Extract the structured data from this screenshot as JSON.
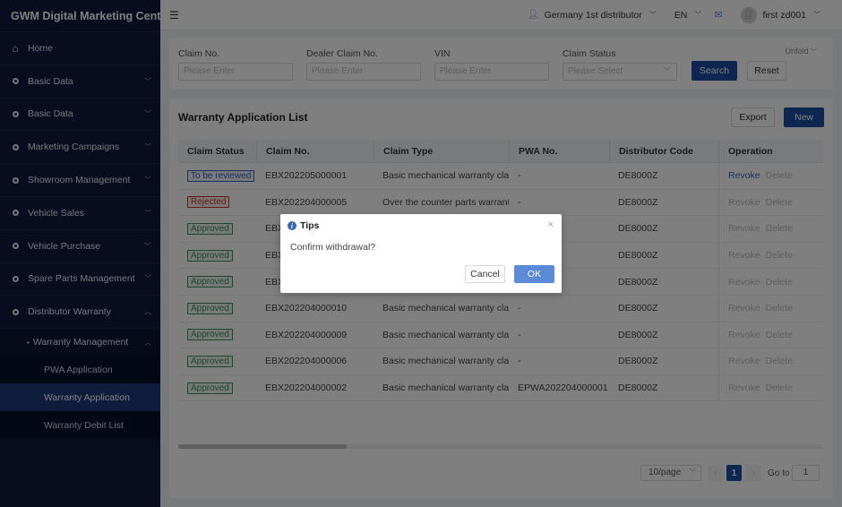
{
  "app": {
    "title": "GWM Digital Marketing Center"
  },
  "sidebar": {
    "items": [
      {
        "label": "Home",
        "icon": "home-icon"
      },
      {
        "label": "Basic Data",
        "icon": "dot-icon"
      },
      {
        "label": "Basic Data",
        "icon": "dot-icon"
      },
      {
        "label": "Marketing Campaigns",
        "icon": "dot-icon"
      },
      {
        "label": "Showroom Management",
        "icon": "dot-icon"
      },
      {
        "label": "Vehicle Sales",
        "icon": "dot-icon"
      },
      {
        "label": "Vehicle Purchase",
        "icon": "dot-icon"
      },
      {
        "label": "Spare Parts Management",
        "icon": "dot-icon"
      },
      {
        "label": "Distributor Warranty",
        "icon": "dot-icon"
      }
    ],
    "submenu": {
      "label": "Warranty Management"
    },
    "leaves": [
      {
        "label": "PWA Application",
        "active": false
      },
      {
        "label": "Warranty Application",
        "active": true
      },
      {
        "label": "Warranty Debit List",
        "active": false
      }
    ]
  },
  "header": {
    "distributor": "Germany 1st distributor",
    "language": "EN",
    "username": "first zd001"
  },
  "filter": {
    "claim_no_label": "Claim No.",
    "claim_no_placeholder": "Please Enter",
    "dealer_claim_label": "Dealer Claim No.",
    "dealer_claim_placeholder": "Please Enter",
    "vin_label": "VIN",
    "vin_placeholder": "Please Enter",
    "status_label": "Claim Status",
    "status_placeholder": "Please Select",
    "search_label": "Search",
    "reset_label": "Reset",
    "unfold_label": "Unfold"
  },
  "list": {
    "title": "Warranty Application List",
    "export_label": "Export",
    "new_label": "New",
    "columns": [
      "Claim Status",
      "Claim No.",
      "Claim Type",
      "PWA No.",
      "Distributor Code",
      "Operation"
    ],
    "rows": [
      {
        "status": "To be reviewed",
        "status_color": "blue",
        "claim_no": "EBX202205000001",
        "type": "Basic mechanical warranty claim",
        "pwa": "-",
        "code": "DE8000Z",
        "revoke": "Revoke",
        "delete": "Delete",
        "revoke_enabled": true
      },
      {
        "status": "Rejected",
        "status_color": "red",
        "claim_no": "EBX202204000005",
        "type": "Over the counter parts warranty claim",
        "pwa": "-",
        "code": "DE8000Z",
        "revoke": "Revoke",
        "delete": "Delete",
        "revoke_enabled": false
      },
      {
        "status": "Approved",
        "status_color": "green",
        "claim_no": "EBX",
        "type": "",
        "pwa": "",
        "code": "DE8000Z",
        "revoke": "Revoke",
        "delete": "Delete",
        "revoke_enabled": false
      },
      {
        "status": "Approved",
        "status_color": "green",
        "claim_no": "EBX",
        "type": "",
        "pwa": "",
        "code": "DE8000Z",
        "revoke": "Revoke",
        "delete": "Delete",
        "revoke_enabled": false
      },
      {
        "status": "Approved",
        "status_color": "green",
        "claim_no": "EBX",
        "type": "",
        "pwa": "",
        "code": "DE8000Z",
        "revoke": "Revoke",
        "delete": "Delete",
        "revoke_enabled": false
      },
      {
        "status": "Approved",
        "status_color": "green",
        "claim_no": "EBX202204000010",
        "type": "Basic mechanical warranty claim",
        "pwa": "-",
        "code": "DE8000Z",
        "revoke": "Revoke",
        "delete": "Delete",
        "revoke_enabled": false
      },
      {
        "status": "Approved",
        "status_color": "green",
        "claim_no": "EBX202204000009",
        "type": "Basic mechanical warranty claim",
        "pwa": "-",
        "code": "DE8000Z",
        "revoke": "Revoke",
        "delete": "Delete",
        "revoke_enabled": false
      },
      {
        "status": "Approved",
        "status_color": "green",
        "claim_no": "EBX202204000006",
        "type": "Basic mechanical warranty claim",
        "pwa": "-",
        "code": "DE8000Z",
        "revoke": "Revoke",
        "delete": "Delete",
        "revoke_enabled": false
      },
      {
        "status": "Approved",
        "status_color": "green",
        "claim_no": "EBX202204000002",
        "type": "Basic mechanical warranty claim",
        "pwa": "EPWA202204000001",
        "code": "DE8000Z",
        "revoke": "Revoke",
        "delete": "Delete",
        "revoke_enabled": false
      }
    ]
  },
  "pagination": {
    "page_size": "10/page",
    "current_page": "1",
    "goto_label": "Go to",
    "goto_value": "1"
  },
  "modal": {
    "title": "Tips",
    "message": "Confirm withdrawal?",
    "cancel_label": "Cancel",
    "ok_label": "OK"
  },
  "colors": {
    "sidebar_bg": "#0e1b3d",
    "primary": "#1a4ea3",
    "ok_button": "#5b8ad6",
    "active_nav": "#1f3a7a"
  }
}
